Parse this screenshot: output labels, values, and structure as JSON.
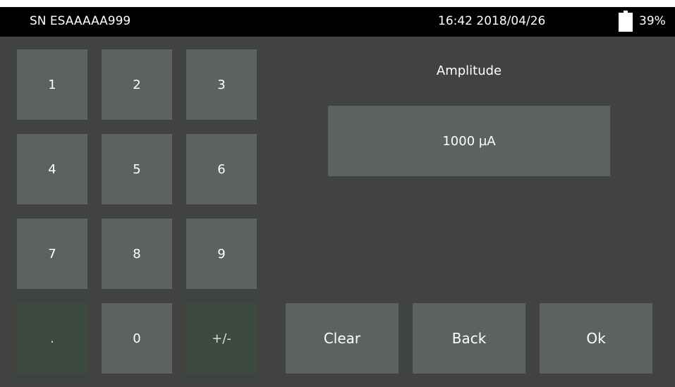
{
  "status_bar": {
    "serial": "SN ESAAAAA999",
    "datetime": "16:42 2018/04/26",
    "battery_icon": "battery-icon",
    "battery_percent": "39%"
  },
  "keypad": {
    "k1": "1",
    "k2": "2",
    "k3": "3",
    "k4": "4",
    "k5": "5",
    "k6": "6",
    "k7": "7",
    "k8": "8",
    "k9": "9",
    "kdot": ".",
    "k0": "0",
    "ksign": "+/-"
  },
  "field": {
    "label": "Amplitude",
    "value": "1000 µA"
  },
  "actions": {
    "clear": "Clear",
    "back": "Back",
    "ok": "Ok"
  },
  "colors": {
    "background": "#404341",
    "button": "#5e625f",
    "disabled_button": "#3d4a3f",
    "status_bar": "#000000",
    "text": "#ffffff"
  }
}
